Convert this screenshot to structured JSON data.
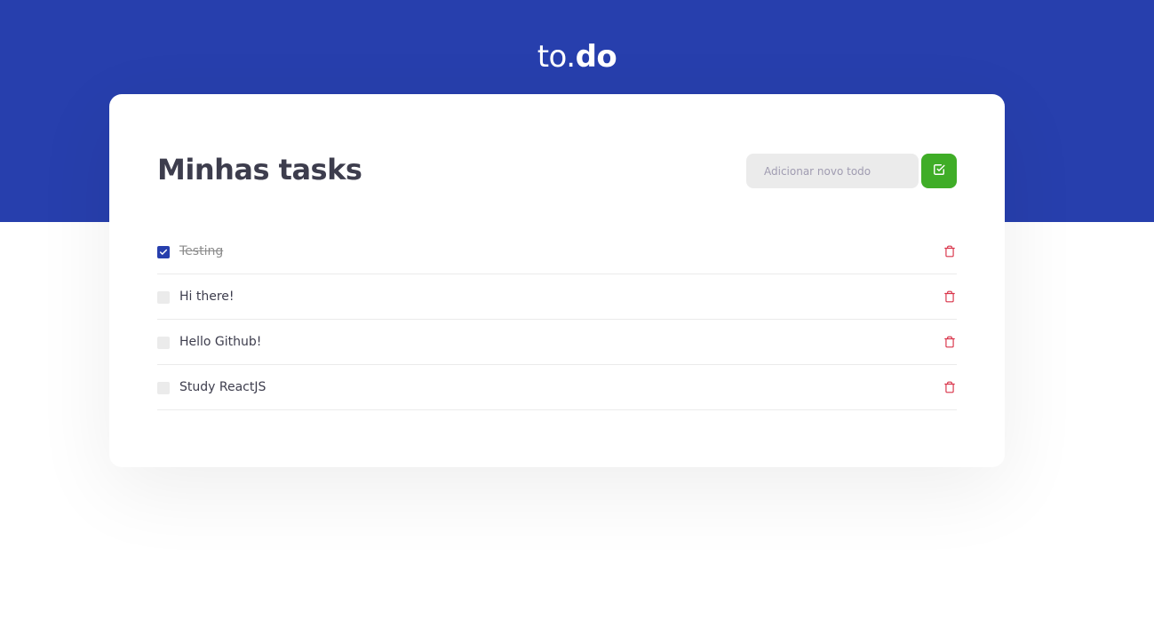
{
  "header": {
    "logo_light": "to.",
    "logo_bold": "do",
    "background": "#273fad"
  },
  "main": {
    "title": "Minhas tasks",
    "new_task": {
      "value": "",
      "placeholder": "Adicionar novo todo"
    },
    "add_button_icon": "check-square-icon",
    "add_button_color": "#3fad27"
  },
  "tasks": [
    {
      "label": "Testing",
      "completed": true,
      "delete_icon": "trash-icon"
    },
    {
      "label": "Hi there!",
      "completed": false,
      "delete_icon": "trash-icon"
    },
    {
      "label": "Hello Github!",
      "completed": false,
      "delete_icon": "trash-icon"
    },
    {
      "label": "Study ReactJS",
      "completed": false,
      "delete_icon": "trash-icon"
    }
  ],
  "colors": {
    "accent": "#273fad",
    "success": "#3fad27",
    "danger": "#d9344a"
  }
}
